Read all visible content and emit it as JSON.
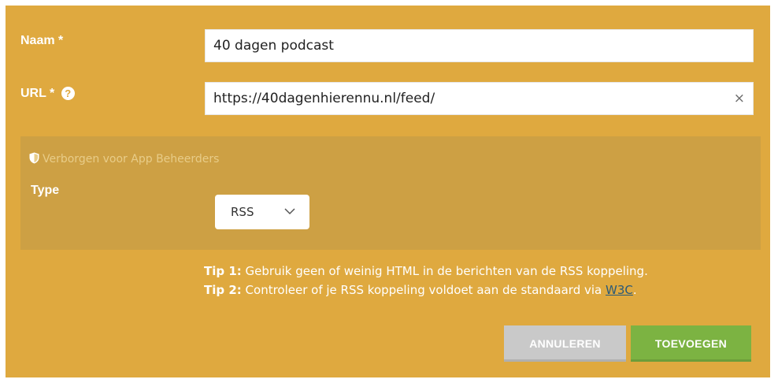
{
  "form": {
    "name_label": "Naam *",
    "name_value": "40 dagen podcast",
    "url_label": "URL *",
    "url_help_icon": "question-circle-icon",
    "url_value": "https://40dagenhierennu.nl/feed/",
    "clear_symbol": "×"
  },
  "hidden_section": {
    "note": "Verborgen voor App Beheerders",
    "icon": "shield-icon",
    "type_label": "Type",
    "type_value": "RSS"
  },
  "tips": {
    "tip1_label": "Tip 1:",
    "tip1_text": " Gebruik geen of weinig HTML in de berichten van de RSS koppeling.",
    "tip2_label": "Tip 2:",
    "tip2_text": " Controleer of je RSS koppeling voldoet aan de standaard via ",
    "tip2_link": "W3C",
    "tip2_end": "."
  },
  "buttons": {
    "cancel": "ANNULEREN",
    "add": "TOEVOEGEN"
  },
  "colors": {
    "panel": "#dfa93f",
    "hidden_panel": "#cda044",
    "cancel": "#c9c9c9",
    "add": "#7cb342"
  }
}
